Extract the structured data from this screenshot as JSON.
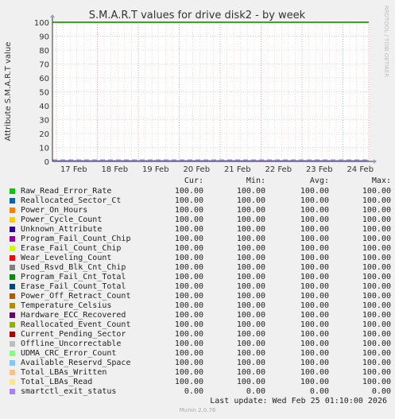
{
  "chart_data": {
    "type": "line",
    "title": "S.M.A.R.T values for drive disk2 - by week",
    "ylabel": "Attribute S.M.A.R.T value",
    "ylim": [
      0,
      100
    ],
    "yticks": [
      "0",
      "10",
      "20",
      "30",
      "40",
      "50",
      "60",
      "70",
      "80",
      "90",
      "100"
    ],
    "xticks": [
      "17 Feb",
      "18 Feb",
      "19 Feb",
      "20 Feb",
      "21 Feb",
      "22 Feb",
      "23 Feb",
      "24 Feb"
    ],
    "grid": true,
    "watermark": "RRDTOOL / TOBI OETIKER",
    "columns": [
      "Cur:",
      "Min:",
      "Avg:",
      "Max:"
    ],
    "series": [
      {
        "name": "Raw_Read_Error_Rate",
        "color": "#00cc00",
        "cur": "100.00",
        "min": "100.00",
        "avg": "100.00",
        "max": "100.00"
      },
      {
        "name": "Reallocated_Sector_Ct",
        "color": "#0066b3",
        "cur": "100.00",
        "min": "100.00",
        "avg": "100.00",
        "max": "100.00"
      },
      {
        "name": "Power_On_Hours",
        "color": "#ff8000",
        "cur": "100.00",
        "min": "100.00",
        "avg": "100.00",
        "max": "100.00"
      },
      {
        "name": "Power_Cycle_Count",
        "color": "#ffcc00",
        "cur": "100.00",
        "min": "100.00",
        "avg": "100.00",
        "max": "100.00"
      },
      {
        "name": "Unknown_Attribute",
        "color": "#330099",
        "cur": "100.00",
        "min": "100.00",
        "avg": "100.00",
        "max": "100.00"
      },
      {
        "name": "Program_Fail_Count_Chip",
        "color": "#990099",
        "cur": "100.00",
        "min": "100.00",
        "avg": "100.00",
        "max": "100.00"
      },
      {
        "name": "Erase_Fail_Count_Chip",
        "color": "#ccff00",
        "cur": "100.00",
        "min": "100.00",
        "avg": "100.00",
        "max": "100.00"
      },
      {
        "name": "Wear_Leveling_Count",
        "color": "#ff0000",
        "cur": "100.00",
        "min": "100.00",
        "avg": "100.00",
        "max": "100.00"
      },
      {
        "name": "Used_Rsvd_Blk_Cnt_Chip",
        "color": "#808080",
        "cur": "100.00",
        "min": "100.00",
        "avg": "100.00",
        "max": "100.00"
      },
      {
        "name": "Program_Fail_Cnt_Total",
        "color": "#008f00",
        "cur": "100.00",
        "min": "100.00",
        "avg": "100.00",
        "max": "100.00"
      },
      {
        "name": "Erase_Fail_Count_Total",
        "color": "#00487d",
        "cur": "100.00",
        "min": "100.00",
        "avg": "100.00",
        "max": "100.00"
      },
      {
        "name": "Power_Off_Retract_Count",
        "color": "#b35a00",
        "cur": "100.00",
        "min": "100.00",
        "avg": "100.00",
        "max": "100.00"
      },
      {
        "name": "Temperature_Celsius",
        "color": "#b38f00",
        "cur": "100.00",
        "min": "100.00",
        "avg": "100.00",
        "max": "100.00"
      },
      {
        "name": "Hardware_ECC_Recovered",
        "color": "#6b006b",
        "cur": "100.00",
        "min": "100.00",
        "avg": "100.00",
        "max": "100.00"
      },
      {
        "name": "Reallocated_Event_Count",
        "color": "#8fb300",
        "cur": "100.00",
        "min": "100.00",
        "avg": "100.00",
        "max": "100.00"
      },
      {
        "name": "Current_Pending_Sector",
        "color": "#b30000",
        "cur": "100.00",
        "min": "100.00",
        "avg": "100.00",
        "max": "100.00"
      },
      {
        "name": "Offline_Uncorrectable",
        "color": "#bebebe",
        "cur": "100.00",
        "min": "100.00",
        "avg": "100.00",
        "max": "100.00"
      },
      {
        "name": "UDMA_CRC_Error_Count",
        "color": "#80ff80",
        "cur": "100.00",
        "min": "100.00",
        "avg": "100.00",
        "max": "100.00"
      },
      {
        "name": "Available_Reservd_Space",
        "color": "#80c9ff",
        "cur": "100.00",
        "min": "100.00",
        "avg": "100.00",
        "max": "100.00"
      },
      {
        "name": "Total_LBAs_Written",
        "color": "#ffc080",
        "cur": "100.00",
        "min": "100.00",
        "avg": "100.00",
        "max": "100.00"
      },
      {
        "name": "Total_LBAs_Read",
        "color": "#ffe680",
        "cur": "100.00",
        "min": "100.00",
        "avg": "100.00",
        "max": "100.00"
      },
      {
        "name": "smartctl_exit_status",
        "color": "#aa80ff",
        "cur": "0.00",
        "min": "0.00",
        "avg": "0.00",
        "max": "0.00"
      }
    ]
  },
  "footer": {
    "last_update": "Last update: Wed Feb 25 01:10:00 2026",
    "version": "Munin 2.0.76"
  }
}
